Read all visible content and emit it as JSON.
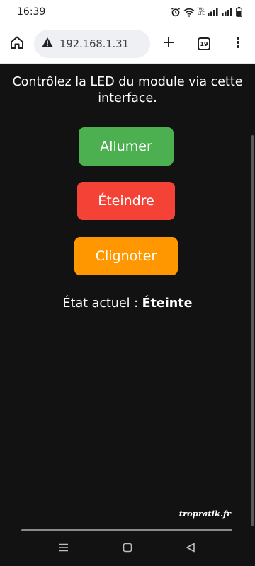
{
  "status_bar": {
    "time": "16:39",
    "volte_top": "Vo",
    "volte_bottom": "LTE"
  },
  "browser": {
    "url": "192.168.1.31",
    "tab_count": "19",
    "icons": [
      "home-icon",
      "warning-icon",
      "plus-icon",
      "tab-switcher-icon",
      "more-vert-icon"
    ]
  },
  "page": {
    "intro": "Contrôlez la LED du module via cette interface.",
    "buttons": {
      "on": "Allumer",
      "off": "Éteindre",
      "blink": "Clignoter"
    },
    "state_label": "État actuel :",
    "state_value": "Éteinte",
    "colors": {
      "on": "#4caf50",
      "off": "#f44336",
      "blink": "#ff9800",
      "background": "#121212"
    }
  },
  "watermark": "tropratik.fr",
  "nav": {
    "icons": [
      "recents-icon",
      "home-icon",
      "back-icon"
    ]
  }
}
